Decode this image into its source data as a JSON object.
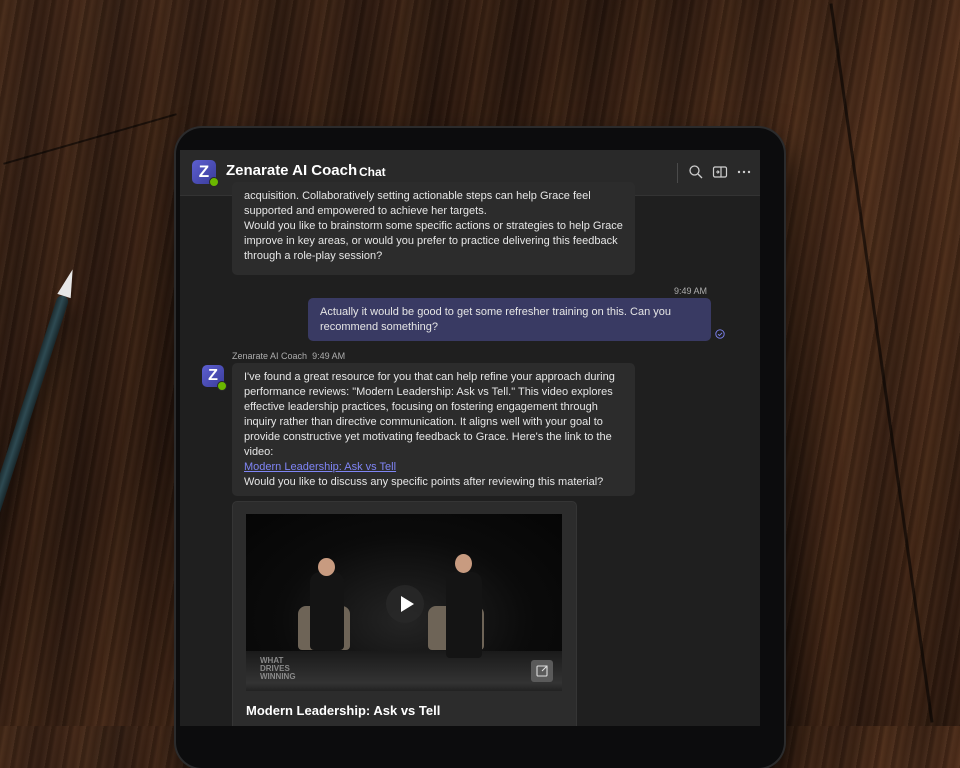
{
  "app": {
    "name": "Zenarate AI Coach",
    "logo_letter": "Z",
    "tab_label": "Chat",
    "accent_color": "#7f85f5",
    "presence_color": "#6bb700"
  },
  "header_icons": [
    "search-icon",
    "popout-icon",
    "more-options-icon"
  ],
  "messages": {
    "m1": {
      "lines": [
        "acquisition. Collaboratively setting actionable steps can help Grace feel supported and empowered to achieve her targets.",
        "Would you like to brainstorm some specific actions or strategies to help Grace improve in key areas, or would you prefer to practice delivering this feedback through a role-play session?"
      ]
    },
    "m2": {
      "timestamp": "9:49 AM",
      "text": "Actually it would be good to get some refresher training on this. Can you recommend something?"
    },
    "m3": {
      "sender": "Zenarate AI Coach",
      "timestamp": "9:49 AM",
      "avatar_letter": "Z",
      "body": "I've found a great resource for you that can help refine your approach during performance reviews: \"Modern Leadership: Ask vs Tell.\" This video explores effective leadership practices, focusing on fostering engagement through inquiry rather than directive communication. It aligns well with your goal to provide constructive yet motivating feedback to Grace. Here's the link to the video:",
      "link_text": "Modern Leadership: Ask vs Tell",
      "closing": "Would you like to discuss any specific points after reviewing this material?"
    }
  },
  "video_card": {
    "title": "Modern Leadership: Ask vs Tell",
    "watermark": [
      "WHAT",
      "DRIVES",
      "WINNING"
    ]
  }
}
